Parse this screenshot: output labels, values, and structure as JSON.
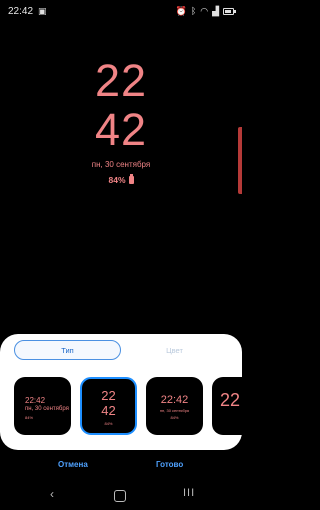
{
  "status_bar": {
    "time": "22:42",
    "icons_left": [
      "image-icon"
    ],
    "icons_right": [
      "alarm-icon",
      "bluetooth-icon",
      "wifi-icon",
      "signal-icon",
      "battery-icon"
    ]
  },
  "clock": {
    "hour": "22",
    "minute": "42",
    "date": "пн, 30 сентября",
    "battery": "84%"
  },
  "colors": {
    "clock": "#f08486",
    "accent": "#1e8fff",
    "edge_handle": "#b53a38"
  },
  "style_sheet": {
    "tabs": [
      {
        "label": "Тип",
        "selected": true
      },
      {
        "label": "Цвет",
        "selected": false
      }
    ],
    "thumbnails": [
      {
        "line1": "22:42",
        "line2": "пн, 30 сентября",
        "line3": "84%",
        "selected": false
      },
      {
        "line1": "22",
        "line2": "42",
        "line3": "84%",
        "selected": true
      },
      {
        "line1": "22:42",
        "line2": "пн, 30 сентября",
        "line3": "84%",
        "selected": false
      },
      {
        "line1": "22",
        "selected": false
      }
    ]
  },
  "actions": {
    "cancel": "Отмена",
    "done": "Готово"
  },
  "nav": {
    "back": "‹",
    "recent": "III"
  }
}
